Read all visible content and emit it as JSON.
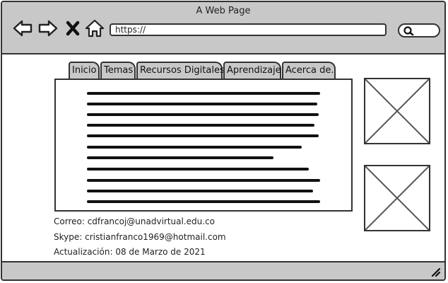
{
  "window": {
    "title": "A Web Page"
  },
  "toolbar": {
    "back_icon": "back-arrow-icon",
    "forward_icon": "forward-arrow-icon",
    "stop_icon": "close-icon",
    "home_icon": "home-icon",
    "url": "https://",
    "search_icon": "search-icon"
  },
  "tabs": [
    {
      "label": "Inicio"
    },
    {
      "label": "Temas"
    },
    {
      "label": "Recursos Digitales"
    },
    {
      "label": "Aprendizaje"
    },
    {
      "label": "Acerca de."
    }
  ],
  "footer_info": {
    "correo": "Correo: cdfrancoj@unadvirtual.edu.co",
    "skype": "Skype: cristianfranco1969@hotmail.com",
    "actualizacion": "Actualización: 08 de Marzo de 2021"
  },
  "colors": {
    "chrome": "#c8c8c8",
    "border": "#333333",
    "background": "#ffffff"
  }
}
